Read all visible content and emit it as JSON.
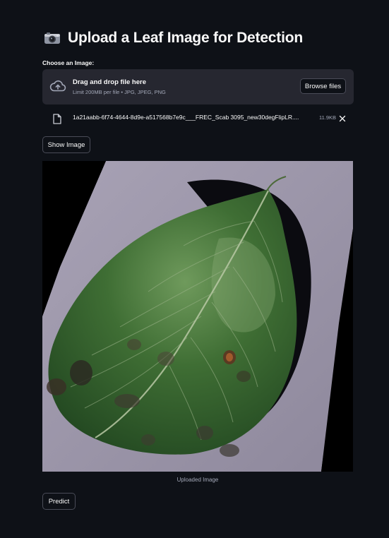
{
  "header": {
    "title": "Upload a Leaf Image for Detection",
    "icon": "camera-icon"
  },
  "uploader": {
    "label": "Choose an Image:",
    "drop_title": "Drag and drop file here",
    "drop_subtitle": "Limit 200MB per file • JPG, JPEG, PNG",
    "browse_label": "Browse files",
    "icon": "cloud-upload-icon"
  },
  "file": {
    "name": "1a21aabb-6f74-4644-8d9e-a517568b7e9c___FREC_Scab 3095_new30degFlipLR....",
    "size": "11.9KB",
    "icon": "file-icon",
    "remove_icon": "close-icon"
  },
  "actions": {
    "show_image_label": "Show Image",
    "predict_label": "Predict"
  },
  "image": {
    "caption": "Uploaded Image",
    "alt": "leaf-image"
  },
  "colors": {
    "background": "#0e1117",
    "surface": "#262730",
    "text": "#fafafa",
    "muted": "#a3a8b8",
    "border": "#4a4c58"
  }
}
